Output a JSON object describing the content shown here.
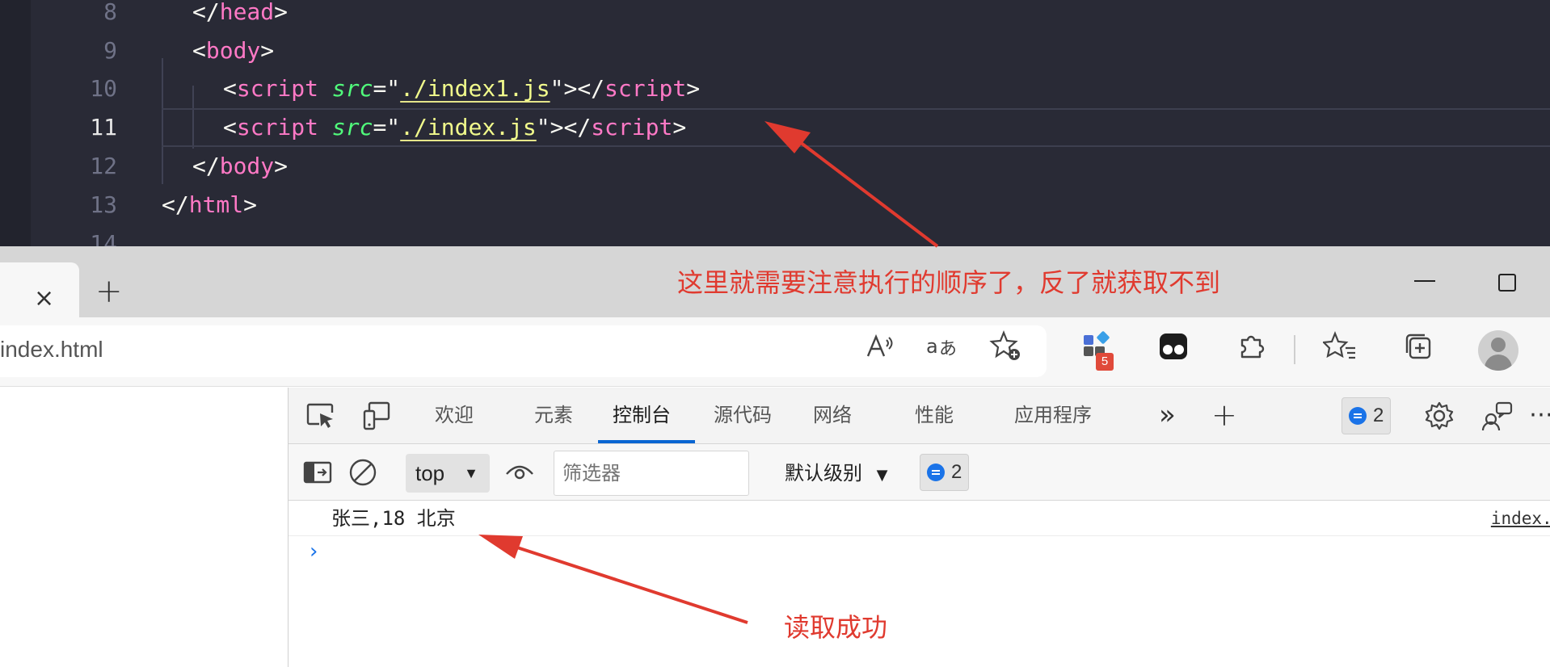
{
  "editor": {
    "lines": [
      {
        "num": "8",
        "tokens": [
          [
            "</",
            "p"
          ],
          [
            "head",
            "tag"
          ],
          [
            ">",
            "p"
          ]
        ]
      },
      {
        "num": "9",
        "tokens": [
          [
            "<",
            "p"
          ],
          [
            "body",
            "tag"
          ],
          [
            ">",
            "p"
          ]
        ]
      },
      {
        "num": "10",
        "tokens": [
          [
            "<",
            "p"
          ],
          [
            "script",
            "tag"
          ],
          [
            " ",
            "p"
          ],
          [
            "src",
            "attr"
          ],
          [
            "=\"",
            "p"
          ],
          [
            "./index1.js",
            "str-ul"
          ],
          [
            "\"",
            "p"
          ],
          [
            "></",
            "p"
          ],
          [
            "script",
            "tag"
          ],
          [
            ">",
            "p"
          ]
        ]
      },
      {
        "num": "11",
        "tokens": [
          [
            "<",
            "p"
          ],
          [
            "script",
            "tag"
          ],
          [
            " ",
            "p"
          ],
          [
            "src",
            "attr"
          ],
          [
            "=\"",
            "p"
          ],
          [
            "./index.js",
            "str-ul"
          ],
          [
            "\"",
            "p"
          ],
          [
            "></",
            "p"
          ],
          [
            "script",
            "tag"
          ],
          [
            ">",
            "p"
          ]
        ]
      },
      {
        "num": "12",
        "tokens": [
          [
            "</",
            "p"
          ],
          [
            "body",
            "tag"
          ],
          [
            ">",
            "p"
          ]
        ]
      },
      {
        "num": "13",
        "tokens": [
          [
            "</",
            "p"
          ],
          [
            "html",
            "tag"
          ],
          [
            ">",
            "p"
          ]
        ]
      },
      {
        "num": "14",
        "tokens": []
      }
    ],
    "active_line": "11"
  },
  "browser": {
    "tab_close": "×",
    "new_tab": "+",
    "address": "index.html",
    "extensions_badge": "5"
  },
  "devtools": {
    "tabs": [
      "欢迎",
      "元素",
      "控制台",
      "源代码",
      "网络",
      "性能",
      "应用程序"
    ],
    "active_tab": "控制台",
    "more_tabs": "»",
    "add_tab": "+",
    "issues_count": "2",
    "console": {
      "context": "top",
      "filter_placeholder": "筛选器",
      "level": "默认级别",
      "issues_count": "2",
      "message": "张三,18 北京",
      "source": "index.js",
      "prompt": "›"
    }
  },
  "annotations": {
    "order_note": "这里就需要注意执行的顺序了，反了就获取不到",
    "success_note": "读取成功",
    "color": "#e03a2f"
  }
}
